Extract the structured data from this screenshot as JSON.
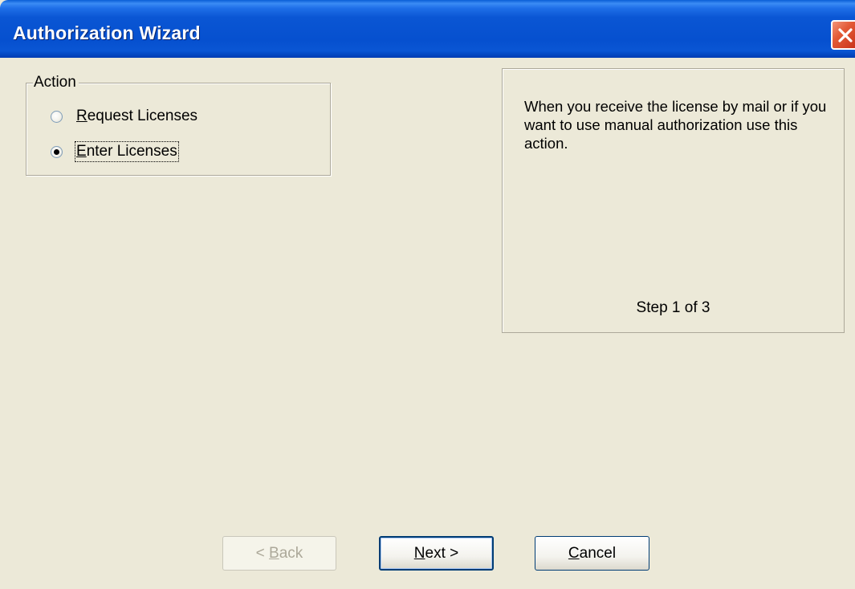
{
  "window": {
    "title": "Authorization Wizard",
    "close_icon": "close-icon"
  },
  "action_group": {
    "legend": "Action",
    "options": [
      {
        "label_mnemonic": "R",
        "label_rest": "equest Licenses",
        "checked": false
      },
      {
        "label_mnemonic": "E",
        "label_rest": "nter Licenses",
        "checked": true
      }
    ]
  },
  "info": {
    "description": "When you receive the license by mail or if you want to use manual authorization use this action.",
    "step": "Step 1 of 3"
  },
  "buttons": {
    "back_prefix": "< ",
    "back_mnemonic": "B",
    "back_rest": "ack",
    "back_enabled": false,
    "next_mnemonic": "N",
    "next_rest": "ext >",
    "cancel_mnemonic": "C",
    "cancel_rest": "ancel"
  },
  "colors": {
    "titlebar": "#0650cf",
    "dialog_bg": "#ece9d8",
    "close_button": "#e35a36"
  }
}
